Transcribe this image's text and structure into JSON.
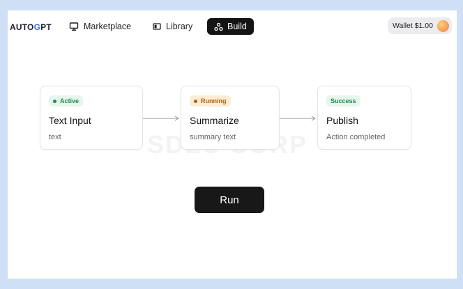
{
  "header": {
    "logo": {
      "prefix": "AUTO",
      "highlight": "G",
      "suffix": "PT"
    },
    "nav": [
      {
        "label": "Marketplace",
        "icon": "monitor-icon"
      },
      {
        "label": "Library",
        "icon": "library-icon"
      },
      {
        "label": "Build",
        "icon": "build-icon",
        "active": true
      }
    ],
    "wallet_label": "Wallet $1.00"
  },
  "watermark": "SDLC CORP",
  "nodes": [
    {
      "status": "Active",
      "status_color": "#1f8a4c",
      "status_bg": "#e6f6ec",
      "title": "Text Input",
      "subtitle": "text"
    },
    {
      "status": "Running",
      "status_color": "#b35d0d",
      "status_bg": "#fdecd5",
      "title": "Summarize",
      "subtitle": "summary text"
    },
    {
      "status": "Success",
      "status_color": "#1f8a4c",
      "status_bg": "#e6f6ec",
      "title": "Publish",
      "subtitle": "Action completed"
    }
  ],
  "run_label": "Run"
}
